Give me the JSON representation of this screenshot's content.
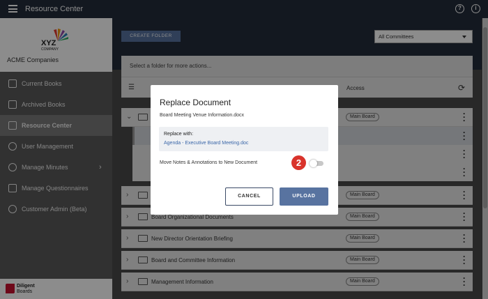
{
  "app": {
    "title": "Resource Center"
  },
  "header": {
    "help_icon": "?",
    "info_icon": "i"
  },
  "sidebar": {
    "logo_text": "XYZ COMPANY",
    "company": "ACME Companies",
    "items": [
      {
        "label": "Current Books",
        "icon": "book-icon"
      },
      {
        "label": "Archived Books",
        "icon": "archive-icon"
      },
      {
        "label": "Resource Center",
        "icon": "library-icon",
        "active": true
      },
      {
        "label": "User Management",
        "icon": "users-icon"
      },
      {
        "label": "Manage Minutes",
        "icon": "clock-icon"
      },
      {
        "label": "Manage Questionnaires",
        "icon": "clipboard-icon"
      },
      {
        "label": "Customer Admin (Beta)",
        "icon": "admin-icon"
      }
    ],
    "footer": {
      "brand": "Diligent",
      "sub": "Boards"
    }
  },
  "toolbar": {
    "create_folder": "CREATE FOLDER",
    "committee_filter": "All Committees"
  },
  "actions": {
    "placeholder": "Select a folder for more actions..."
  },
  "table": {
    "access_header": "Access"
  },
  "folders": [
    {
      "name": "",
      "access": "Main Board",
      "expanded": true
    },
    {
      "name": "",
      "access": "Main Board"
    },
    {
      "name": "Board Organizational Documents",
      "access": "Main Board"
    },
    {
      "name": "New Director Orientation Briefing",
      "access": "Main Board"
    },
    {
      "name": "Board and Committee Information",
      "access": "Main Board"
    },
    {
      "name": "Management Information",
      "access": "Main Board"
    }
  ],
  "modal": {
    "title": "Replace Document",
    "filename": "Board Meeting Venue Information.docx",
    "replace_label": "Replace with:",
    "replace_value": "Agenda - Executive Board Meeting.doc",
    "move_label": "Move Notes & Annotations to New Document",
    "step_number": "2",
    "cancel": "CANCEL",
    "upload": "UPLOAD"
  },
  "colors": {
    "topbar": "#232c3b",
    "accent": "#5873a0",
    "step": "#d9332b"
  }
}
